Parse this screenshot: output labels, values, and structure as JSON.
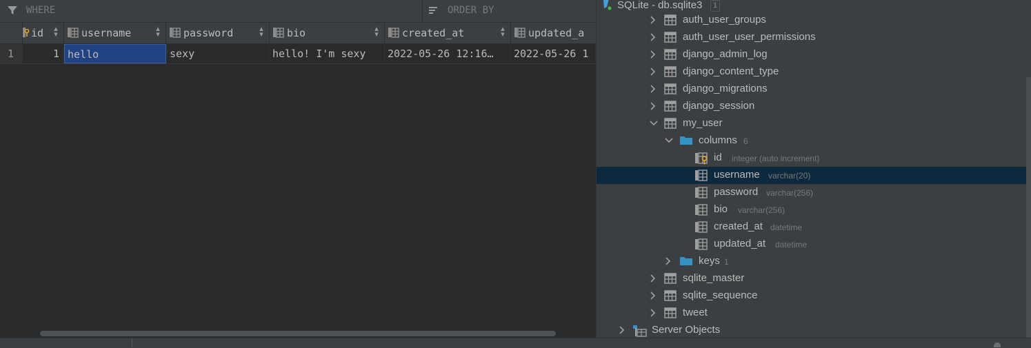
{
  "filter_bar": {
    "where_label": "WHERE",
    "order_by_label": "ORDER BY"
  },
  "grid": {
    "columns": [
      {
        "label": "id",
        "icon": "primary-key-column-icon"
      },
      {
        "label": "username",
        "icon": "column-icon"
      },
      {
        "label": "password",
        "icon": "column-icon"
      },
      {
        "label": "bio",
        "icon": "column-icon"
      },
      {
        "label": "created_at",
        "icon": "column-icon"
      },
      {
        "label": "updated_a",
        "icon": "column-icon"
      }
    ],
    "rows": [
      {
        "row_number": "1",
        "id": "1",
        "username": "hello",
        "password": "sexy",
        "bio": "hello! I'm sexy",
        "created_at": "2022-05-26 12:16…",
        "updated_at": "2022-05-26 1"
      }
    ]
  },
  "tree": {
    "root": {
      "label": "SQLite - db.sqlite3",
      "badge": "1"
    },
    "tables_before": [
      {
        "label": "auth_user_groups"
      },
      {
        "label": "auth_user_user_permissions"
      },
      {
        "label": "django_admin_log"
      },
      {
        "label": "django_content_type"
      },
      {
        "label": "django_migrations"
      },
      {
        "label": "django_session"
      }
    ],
    "expanded_table": {
      "label": "my_user"
    },
    "columns_folder": {
      "label": "columns",
      "count": "6"
    },
    "columns": [
      {
        "name": "id",
        "type": "integer (auto increment)"
      },
      {
        "name": "username",
        "type": "varchar(20)"
      },
      {
        "name": "password",
        "type": "varchar(256)"
      },
      {
        "name": "bio",
        "type": "varchar(256)"
      },
      {
        "name": "created_at",
        "type": "datetime"
      },
      {
        "name": "updated_at",
        "type": "datetime"
      }
    ],
    "keys_folder": {
      "label": "keys",
      "count": "1"
    },
    "tables_after": [
      {
        "label": "sqlite_master"
      },
      {
        "label": "sqlite_sequence"
      },
      {
        "label": "tweet"
      }
    ],
    "server_objects": {
      "label": "Server Objects"
    }
  },
  "colors": {
    "selection": "#214283",
    "tree_selection": "#0d293e",
    "folder": "#3592c4",
    "key": "#e0a531"
  }
}
